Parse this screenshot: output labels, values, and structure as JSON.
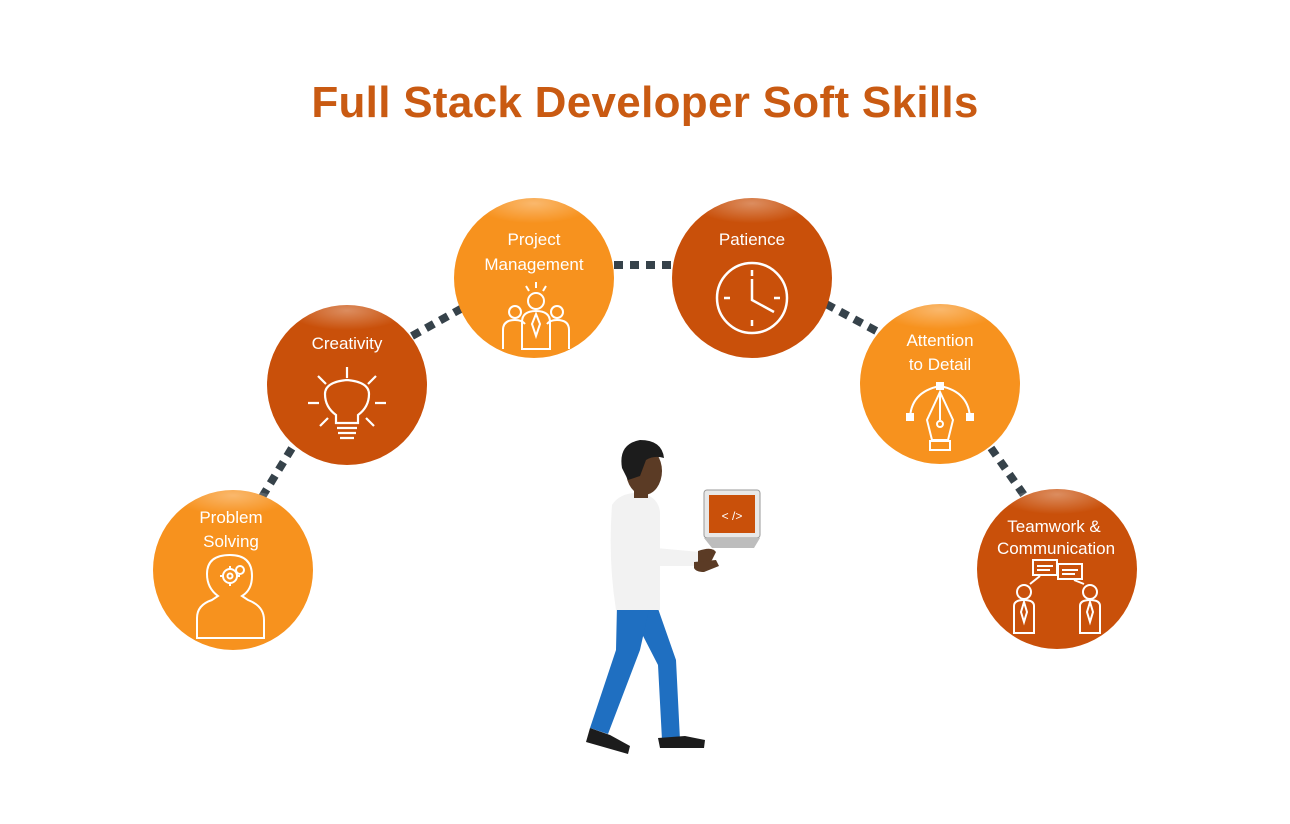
{
  "title": "Full Stack Developer Soft Skills",
  "colors": {
    "title": "#c95a12",
    "light_orange": "#f7921e",
    "dark_orange": "#c9500a",
    "connector": "#36424a"
  },
  "skills": [
    {
      "lines": [
        "Problem",
        "Solving"
      ],
      "icon": "head-gears-icon",
      "tone": "light"
    },
    {
      "lines": [
        "Creativity"
      ],
      "icon": "lightbulb-icon",
      "tone": "dark"
    },
    {
      "lines": [
        "Project",
        "Management"
      ],
      "icon": "team-icon",
      "tone": "light"
    },
    {
      "lines": [
        "Patience"
      ],
      "icon": "clock-icon",
      "tone": "dark"
    },
    {
      "lines": [
        "Attention",
        "to Detail"
      ],
      "icon": "pen-tool-icon",
      "tone": "light"
    },
    {
      "lines": [
        "Teamwork &",
        "Communication"
      ],
      "icon": "chat-people-icon",
      "tone": "dark"
    }
  ],
  "laptop_screen_text": "< />"
}
